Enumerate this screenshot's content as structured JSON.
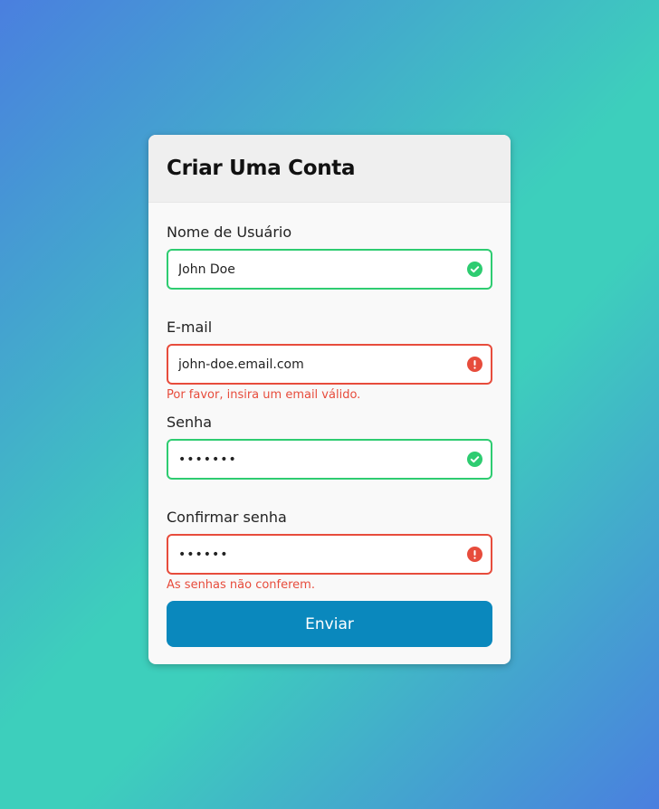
{
  "form": {
    "title": "Criar Uma Conta",
    "fields": [
      {
        "label": "Nome de Usuário",
        "value": "John Doe",
        "type": "text",
        "status": "success",
        "error": ""
      },
      {
        "label": "E-mail",
        "value": "john-doe.email.com",
        "type": "text",
        "status": "error",
        "error": "Por favor, insira um email válido."
      },
      {
        "label": "Senha",
        "value": "1234567",
        "type": "password",
        "status": "success",
        "error": ""
      },
      {
        "label": "Confirmar senha",
        "value": "123456",
        "type": "password",
        "status": "error",
        "error": "As senhas não conferem."
      }
    ],
    "submit_label": "Enviar"
  },
  "colors": {
    "success": "#2ecc71",
    "error": "#e74c3c",
    "button": "#0a88bd"
  },
  "icons": {
    "success": "check-circle-icon",
    "error": "exclamation-circle-icon"
  }
}
